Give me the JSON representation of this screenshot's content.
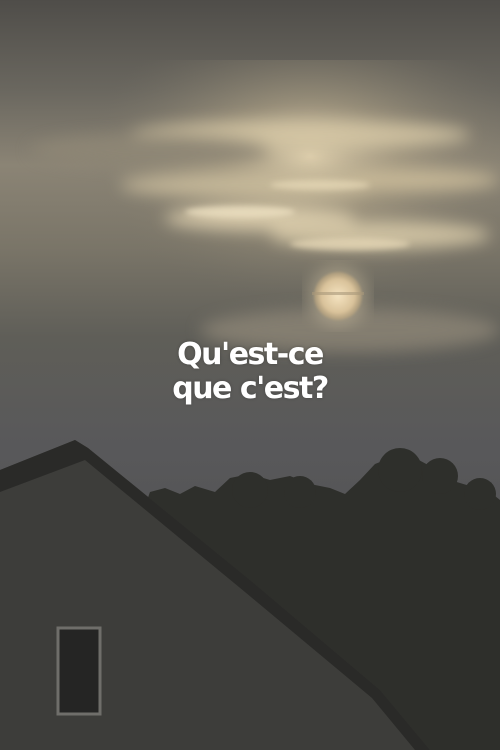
{
  "poster": {
    "title_line_1": "Qu'est-ce",
    "title_line_2": "que c'est?"
  },
  "colors": {
    "sky_top": "#6a675f",
    "sky_glow": "#d8c9a6",
    "sky_low": "#5f5e58",
    "silhouette": "#2c2c2a",
    "title_text": "#ffffff"
  },
  "icons": {
    "sun": "sun-disc",
    "house": "house-roof-silhouette",
    "trees": "tree-line-silhouette"
  }
}
